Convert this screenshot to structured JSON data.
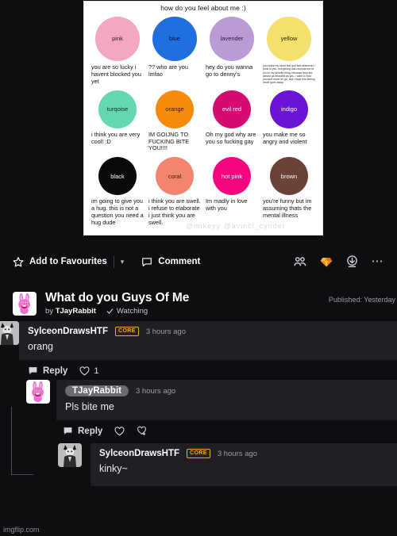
{
  "meme": {
    "title": "how do you feel about me :)",
    "watermark": "@mikeyy @avinci_cynder",
    "cells": [
      {
        "label": "pink",
        "color": "#f4a7c0",
        "text_color": "#222",
        "size": 56,
        "text": "you are so lucky i havent blocked you yet",
        "tiny": false
      },
      {
        "label": "blue",
        "color": "#1f6fe0",
        "text_color": "#0b1020",
        "size": 56,
        "text": "?? who are you lmfao",
        "tiny": false
      },
      {
        "label": "lavender",
        "color": "#bb9bd6",
        "text_color": "#241a33",
        "size": 56,
        "text": "hey do you wanna go to denny's",
        "tiny": false
      },
      {
        "label": "yellow",
        "color": "#f4e06a",
        "text_color": "#2b2510",
        "size": 56,
        "text": "you make my heart feel and feel whenever i think of you. everything that reminds me of you is my favorite thing, because they are almost as beautiful as you. i want to hold you and never let go, and i hope this feeling never goes away.",
        "tiny": true
      },
      {
        "label": "turqoise",
        "color": "#63d7ad",
        "text_color": "#10302a",
        "size": 48,
        "text": "i think you are very cool! :D",
        "tiny": false
      },
      {
        "label": "orange",
        "color": "#f58a0b",
        "text_color": "#3a1d00",
        "size": 48,
        "text": "IM GOIJNG TO FUCKING BITE YOU!!!!",
        "tiny": false
      },
      {
        "label": "evil red",
        "color": "#d60a73",
        "text_color": "#ffffff",
        "size": 48,
        "text": "Oh my god why are you so fucking gay",
        "tiny": false
      },
      {
        "label": "indigo",
        "color": "#6a14d6",
        "text_color": "#ffffff",
        "size": 48,
        "text": "you make me so angry and violent",
        "tiny": false
      },
      {
        "label": "black",
        "color": "#0a0a0a",
        "text_color": "#ffffff",
        "size": 48,
        "text": "im going to give you a hug. this is not a question you need a hug dude",
        "tiny": false
      },
      {
        "label": "coral",
        "color": "#f3856f",
        "text_color": "#3a140c",
        "size": 48,
        "text": "i think you are swell. i refuse to elaborate i just think you are swell.",
        "tiny": false
      },
      {
        "label": "hot pink",
        "color": "#f5047f",
        "text_color": "#ffffff",
        "size": 48,
        "text": "Im madly in love with you",
        "tiny": false
      },
      {
        "label": "brown",
        "color": "#6b4138",
        "text_color": "#ffffff",
        "size": 48,
        "text": "you're funny but im assuming thats the mental illness",
        "tiny": false
      }
    ]
  },
  "actionbar": {
    "favourites_label": "Add to Favourites",
    "comment_label": "Comment",
    "icons": [
      "group-icon",
      "gem-icon",
      "download-icon",
      "more-icon"
    ]
  },
  "post": {
    "title": "What do you Guys Of Me",
    "by_prefix": "by",
    "author": "TJayRabbit",
    "watching_label": "Watching",
    "published": "Published: Yesterday"
  },
  "comments": [
    {
      "user": "SylceonDrawsHTF",
      "badge": "CORE",
      "time": "3 hours ago",
      "text": "orang",
      "reply_label": "Reply",
      "like_count": "1",
      "avatar": "sylceon-avatar",
      "is_author": false
    },
    {
      "user": "TJayRabbit",
      "badge": "",
      "time": "3 hours ago",
      "text": "Pls bite me",
      "reply_label": "Reply",
      "like_count": "",
      "avatar": "rabbit-avatar",
      "is_author": true
    },
    {
      "user": "SylceonDrawsHTF",
      "badge": "CORE",
      "time": "3 hours ago",
      "text": "kinky~",
      "reply_label": "",
      "like_count": "",
      "avatar": "sylceon-avatar",
      "is_author": false
    }
  ],
  "footer": {
    "watermark": "imgflip.com"
  },
  "colors": {
    "background": "#0e0e10",
    "bubble": "#202024",
    "accent_orange": "#f0a93c",
    "gem": "#f58a1f"
  }
}
